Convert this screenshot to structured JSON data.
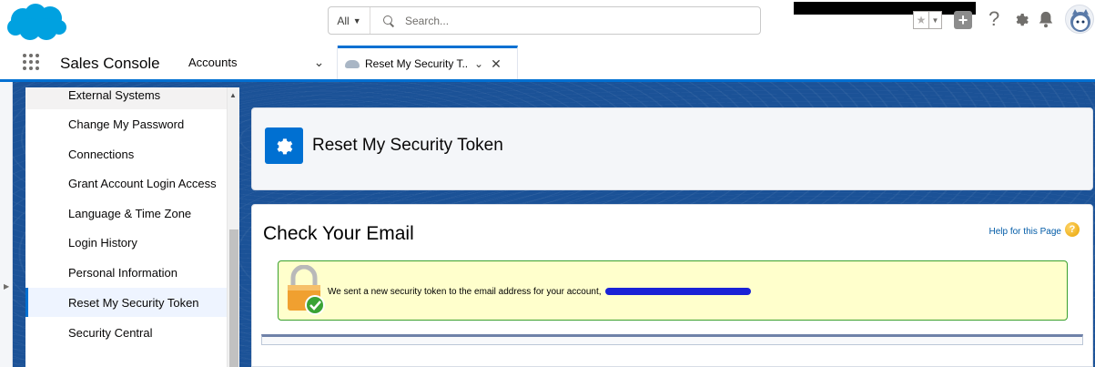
{
  "header": {
    "search_scope": "All",
    "search_placeholder": "Search...",
    "icons": [
      "salesforce-logo",
      "search-icon",
      "star-icon",
      "plus-icon",
      "help-icon",
      "gear-icon",
      "bell-icon",
      "avatar"
    ]
  },
  "nav": {
    "app_name": "Sales Console",
    "object_menu": "Accounts",
    "active_tab_label": "Reset My Security T..."
  },
  "sidebar": {
    "items": [
      {
        "label": "External Systems"
      },
      {
        "label": "Change My Password"
      },
      {
        "label": "Connections"
      },
      {
        "label": "Grant Account Login Access"
      },
      {
        "label": "Language & Time Zone"
      },
      {
        "label": "Login History"
      },
      {
        "label": "Personal Information"
      },
      {
        "label": "Reset My Security Token",
        "active": true
      },
      {
        "label": "Security Central"
      }
    ]
  },
  "page": {
    "title": "Reset My Security Token",
    "section_title": "Check Your Email",
    "help_link": "Help for this Page",
    "message": "We sent a new security token to the email address for your account,"
  },
  "colors": {
    "brand": "#0070d2",
    "workspace_bg": "#1b5297",
    "message_bg": "#ffffcc",
    "message_border": "#39a02d"
  }
}
